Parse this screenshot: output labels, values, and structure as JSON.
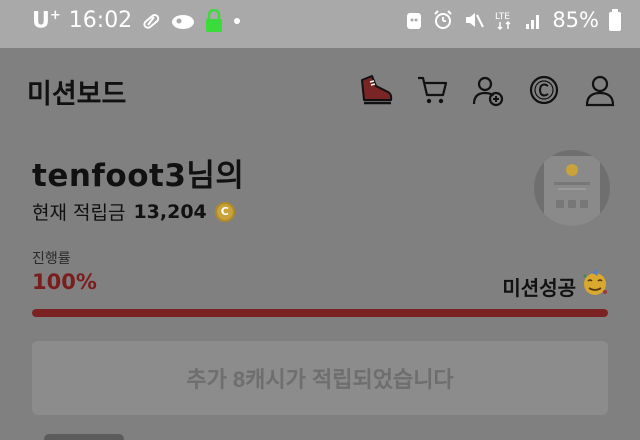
{
  "status_bar": {
    "carrier": "U",
    "carrier_sup": "+",
    "time": "16:02",
    "battery": "85%",
    "lte": "LTE"
  },
  "header": {
    "title": "미션보드",
    "icons": [
      "shoe-icon",
      "cart-icon",
      "add-friend-icon",
      "coin-c-icon",
      "profile-icon"
    ]
  },
  "user": {
    "name": "tenfoot3님의",
    "points_label": "현재 적립금",
    "points_value": "13,204",
    "coin_symbol": "C"
  },
  "progress": {
    "label": "진행률",
    "percent_text": "100%",
    "value": 1.0,
    "status": "미션성공",
    "party_emoji": "🥳"
  },
  "reward": {
    "button_text": "추가 8캐시가 적립되었습니다"
  },
  "colors": {
    "accent": "#7b2222",
    "overlay": "#808080",
    "status_bar": "#a9a9a9",
    "lock_green": "#3adb3a"
  }
}
